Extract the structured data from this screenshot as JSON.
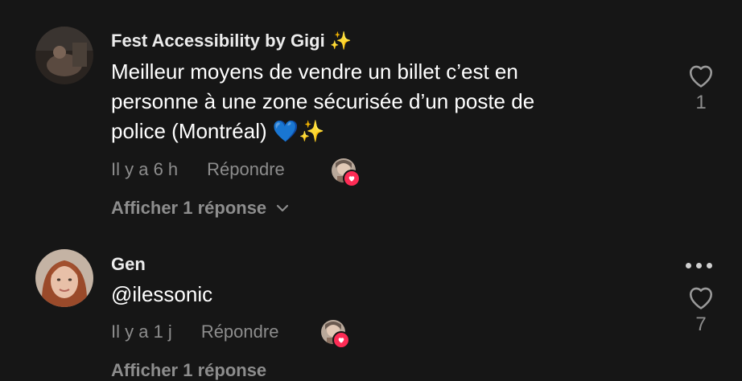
{
  "comments": [
    {
      "author": "Fest Accessibility by Gigi ✨",
      "text_lines": [
        "Meilleur moyens de vendre un billet c’est en",
        "personne à une zone sécurisée d’un poste de",
        "police (Montréal) 💙✨"
      ],
      "time": "Il y a 6 h",
      "reply_label": "Répondre",
      "replies_label": "Afficher 1 réponse",
      "likes": "1"
    },
    {
      "author": "Gen",
      "text_lines": [
        "@ilessonic"
      ],
      "time": "Il y a 1 j",
      "reply_label": "Répondre",
      "replies_label": "Afficher 1 réponse",
      "likes": "7"
    }
  ],
  "icons": {
    "like": "heart-outline-icon",
    "more": "more-horizontal-icon",
    "expand": "chevron-down-icon",
    "creator_badge": "heart-badge-icon"
  },
  "colors": {
    "background": "#161616",
    "muted": "#8d8d8d",
    "badge": "#fe2c55"
  }
}
